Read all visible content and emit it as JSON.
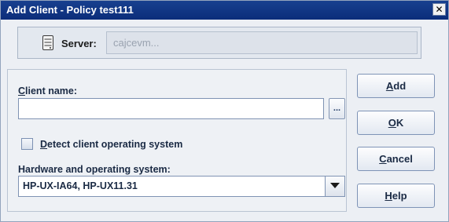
{
  "window": {
    "title": "Add Client - Policy test111",
    "close_label": "✕"
  },
  "server": {
    "label": "Server:",
    "value": "cajcevm..."
  },
  "client_name": {
    "label_mnemonic": "C",
    "label_rest": "lient name:",
    "value": "",
    "browse_label": "..."
  },
  "detect_os": {
    "label_mnemonic": "D",
    "label_rest": "etect client operating system",
    "checked": false
  },
  "hardware_os": {
    "label": "Hardware and operating system:",
    "selected": "HP-UX-IA64, HP-UX11.31"
  },
  "buttons": {
    "add": {
      "mnemonic": "A",
      "rest": "dd"
    },
    "ok": {
      "mnemonic": "O",
      "rest": "K"
    },
    "cancel": {
      "mnemonic": "C",
      "rest": "ancel"
    },
    "help": {
      "mnemonic": "H",
      "rest": "elp"
    }
  },
  "icons": {
    "server": "server-icon",
    "dropdown": "chevron-down-icon"
  }
}
